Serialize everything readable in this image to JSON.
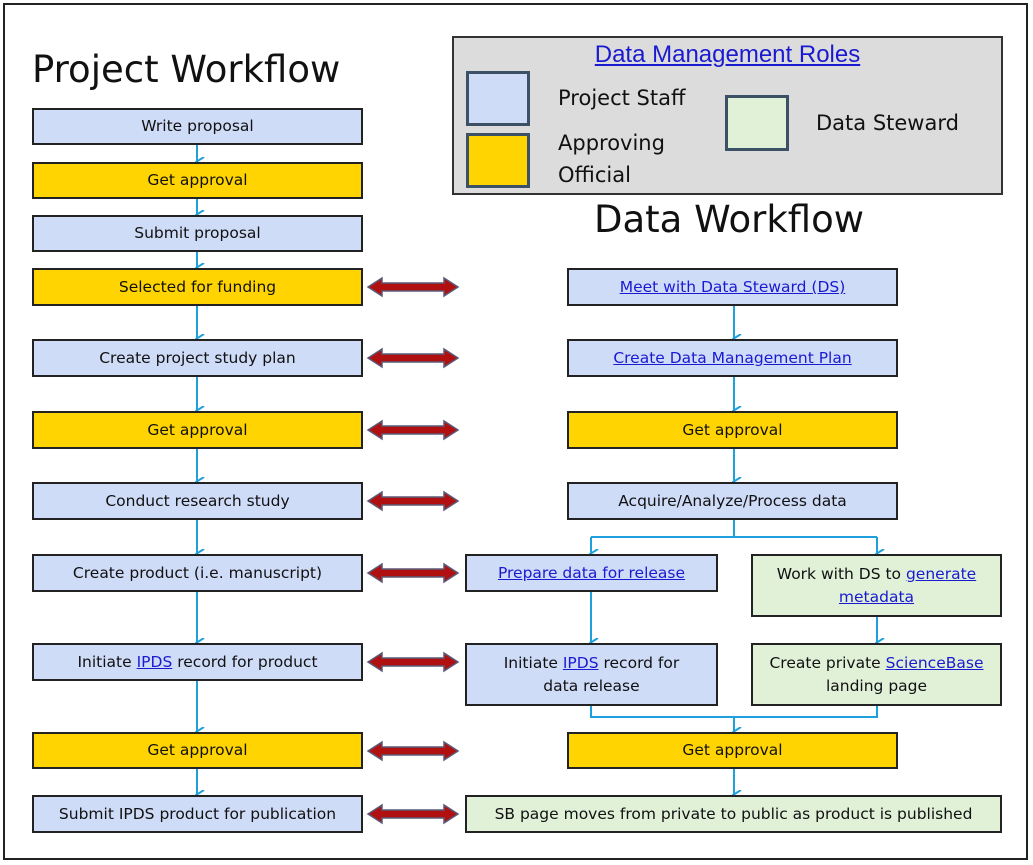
{
  "colors": {
    "project_staff": "#cfdcf8",
    "approving_official": "#ffd400",
    "data_steward": "#e0f1d8",
    "flow_arrow": "#1ea0dc",
    "link_arrow": "#b01010",
    "legend_bg": "#dcdcdc",
    "link_text": "#1a1ad0"
  },
  "legend": {
    "title": "Data Management Roles",
    "items": [
      {
        "role": "project_staff",
        "label": "Project Staff"
      },
      {
        "role": "approving_official",
        "label_line1": "Approving",
        "label_line2": "Official"
      },
      {
        "role": "data_steward",
        "label": "Data Steward"
      }
    ]
  },
  "project_workflow": {
    "title": "Project Workflow",
    "steps": [
      {
        "role": "project_staff",
        "text": "Write proposal"
      },
      {
        "role": "approving_official",
        "text": "Get approval"
      },
      {
        "role": "project_staff",
        "text": "Submit proposal"
      },
      {
        "role": "approving_official",
        "text": "Selected for funding"
      },
      {
        "role": "project_staff",
        "text": "Create project study plan"
      },
      {
        "role": "approving_official",
        "text": "Get approval"
      },
      {
        "role": "project_staff",
        "text": "Conduct research study"
      },
      {
        "role": "project_staff",
        "text": "Create product (i.e. manuscript)"
      },
      {
        "role": "project_staff",
        "pre": "Initiate ",
        "link": "IPDS",
        "post": " record for product"
      },
      {
        "role": "approving_official",
        "text": "Get approval"
      },
      {
        "role": "project_staff",
        "text": "Submit IPDS product for publication"
      }
    ]
  },
  "data_workflow": {
    "title": "Data Workflow",
    "steps": {
      "meet_ds": {
        "role": "project_staff",
        "link": "Meet with Data Steward (DS)"
      },
      "create_dmp": {
        "role": "project_staff",
        "link": "Create Data Management Plan"
      },
      "approval_1": {
        "role": "approving_official",
        "text": "Get approval"
      },
      "acquire": {
        "role": "project_staff",
        "text": "Acquire/Analyze/Process data"
      },
      "prepare": {
        "role": "project_staff",
        "link": "Prepare data for release"
      },
      "metadata": {
        "role": "data_steward",
        "pre": "Work with DS to ",
        "link1": "generate",
        "link2": "metadata"
      },
      "ipds_release": {
        "role": "project_staff",
        "pre": "Initiate ",
        "link": "IPDS",
        "post": " record for",
        "line2": "data release"
      },
      "sciencebase": {
        "role": "data_steward",
        "pre": "Create private ",
        "link": "ScienceBase",
        "line2": "landing page"
      },
      "approval_2": {
        "role": "approving_official",
        "text": "Get approval"
      },
      "sb_public": {
        "role": "data_steward",
        "text": "SB page moves from private to public as product is published"
      }
    }
  }
}
